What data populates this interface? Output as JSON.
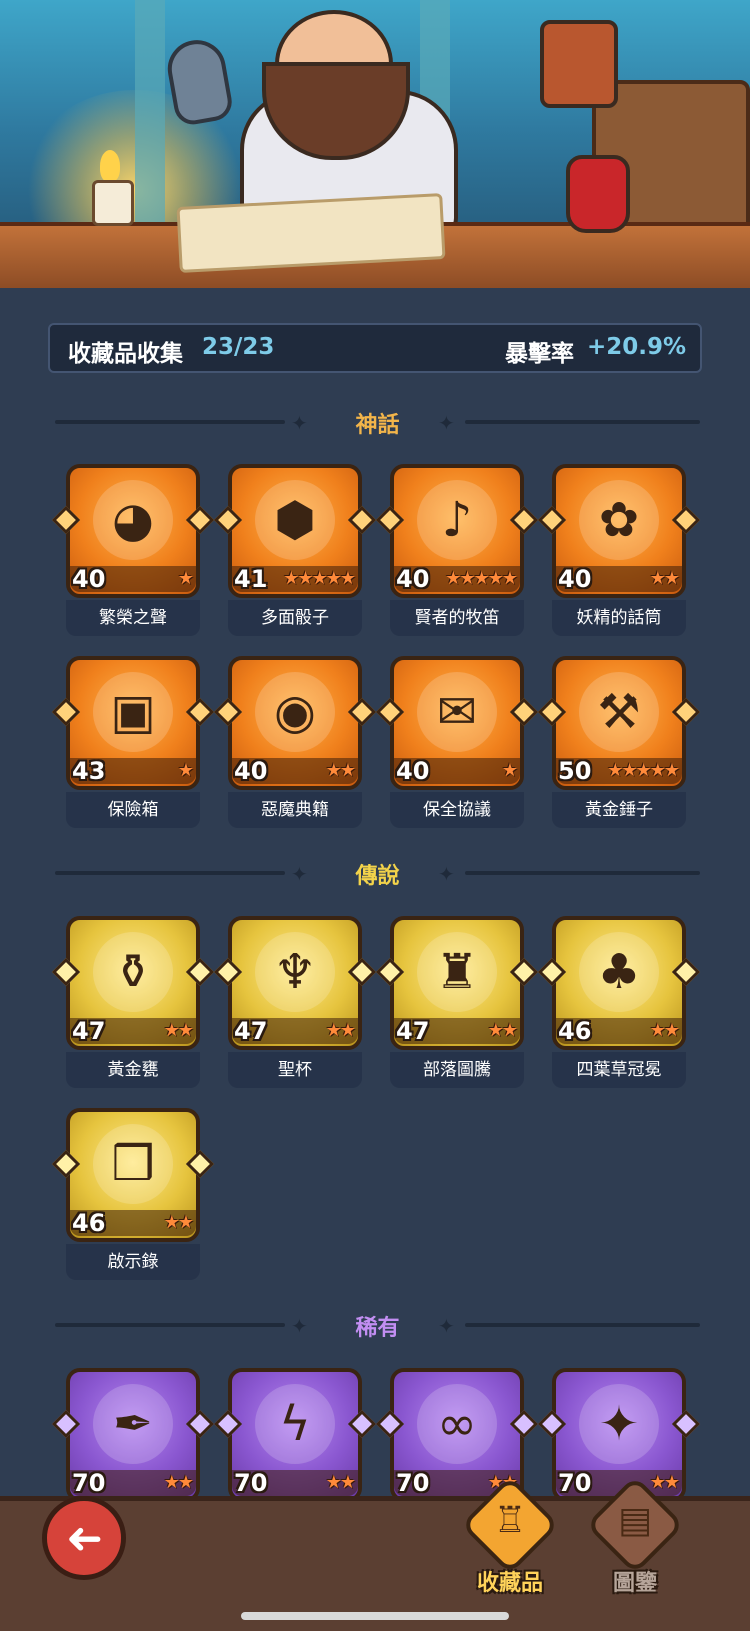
{
  "summary": {
    "collection_label": "收藏品收集",
    "collection_count": "23/23",
    "crit_label": "暴擊率",
    "crit_value": "+20.9%"
  },
  "colors": {
    "mythic": "#f0801c",
    "legendary": "#e6c43e",
    "rare": "#8a57d0",
    "mythic_title": "#f3b54a",
    "legendary_title": "#f3d34a",
    "rare_title": "#c28ef2"
  },
  "sections": {
    "mythic": {
      "title": "神話",
      "items": [
        {
          "name": "繁榮之聲",
          "level": "40",
          "stars": 1,
          "icon": "spirit-orb-icon",
          "glyph": "◕"
        },
        {
          "name": "多面骰子",
          "level": "41",
          "stars": 5,
          "icon": "dice-icon",
          "glyph": "⬢"
        },
        {
          "name": "賢者的牧笛",
          "level": "40",
          "stars": 5,
          "icon": "flute-icon",
          "glyph": "♪"
        },
        {
          "name": "妖精的話筒",
          "level": "40",
          "stars": 2,
          "icon": "fairy-microphone-icon",
          "glyph": "✿"
        },
        {
          "name": "保險箱",
          "level": "43",
          "stars": 1,
          "icon": "treasure-chest-icon",
          "glyph": "▣"
        },
        {
          "name": "惡魔典籍",
          "level": "40",
          "stars": 2,
          "icon": "demon-book-icon",
          "glyph": "◉"
        },
        {
          "name": "保全協議",
          "level": "40",
          "stars": 1,
          "icon": "scroll-icon",
          "glyph": "✉"
        },
        {
          "name": "黃金錘子",
          "level": "50",
          "stars": 5,
          "icon": "hammer-icon",
          "glyph": "⚒"
        }
      ]
    },
    "legendary": {
      "title": "傳說",
      "items": [
        {
          "name": "黃金甕",
          "level": "47",
          "stars": 2,
          "icon": "golden-urn-icon",
          "glyph": "⚱"
        },
        {
          "name": "聖杯",
          "level": "47",
          "stars": 2,
          "icon": "chalice-icon",
          "glyph": "♆"
        },
        {
          "name": "部落圖騰",
          "level": "47",
          "stars": 2,
          "icon": "tribal-totem-icon",
          "glyph": "♜"
        },
        {
          "name": "四葉草冠冕",
          "level": "46",
          "stars": 2,
          "icon": "clover-crown-icon",
          "glyph": "♣"
        },
        {
          "name": "啟示錄",
          "level": "46",
          "stars": 2,
          "icon": "open-book-icon",
          "glyph": "❒"
        }
      ]
    },
    "rare": {
      "title": "稀有",
      "items": [
        {
          "name": "",
          "level": "70",
          "stars": 2,
          "icon": "feather-icon",
          "glyph": "✒"
        },
        {
          "name": "",
          "level": "70",
          "stars": 2,
          "icon": "lightning-gem-icon",
          "glyph": "ϟ"
        },
        {
          "name": "",
          "level": "70",
          "stars": 2,
          "icon": "vine-shackles-icon",
          "glyph": "∞"
        },
        {
          "name": "",
          "level": "70",
          "stars": 2,
          "icon": "ice-dagger-icon",
          "glyph": "✦"
        }
      ]
    }
  },
  "nav": {
    "back_icon": "back-arrow-icon",
    "back_glyph": "➜",
    "collection_label": "收藏品",
    "collection_glyph": "♖",
    "codex_label": "圖鑒",
    "codex_glyph": "▤"
  }
}
